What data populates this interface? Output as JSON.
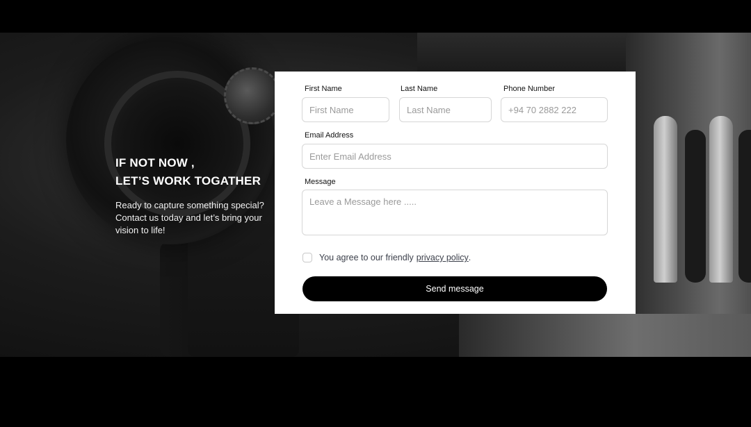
{
  "intro": {
    "title_line1": "IF NOT NOW ,",
    "title_line2": "LET’S WORK TOGATHER",
    "text": "Ready to capture something special? Contact us today and let’s bring your vision to life!"
  },
  "form": {
    "first_name": {
      "label": "First Name",
      "placeholder": "First Name",
      "value": ""
    },
    "last_name": {
      "label": "Last Name",
      "placeholder": "Last Name",
      "value": ""
    },
    "phone": {
      "label": "Phone Number",
      "placeholder": "+94 70 2882 222",
      "value": ""
    },
    "email": {
      "label": "Email Address",
      "placeholder": "Enter Email Address",
      "value": ""
    },
    "message": {
      "label": "Message",
      "placeholder": "Leave a Message here .....",
      "value": ""
    },
    "agree_text": "You agree to our friendly",
    "privacy_link": "privacy policy",
    "agree_suffix": ".",
    "agree_checked": false,
    "submit_label": "Send message"
  },
  "colors": {
    "page_background": "#000000",
    "card_background": "#ffffff",
    "button_background": "#000000",
    "button_text": "#ffffff"
  }
}
